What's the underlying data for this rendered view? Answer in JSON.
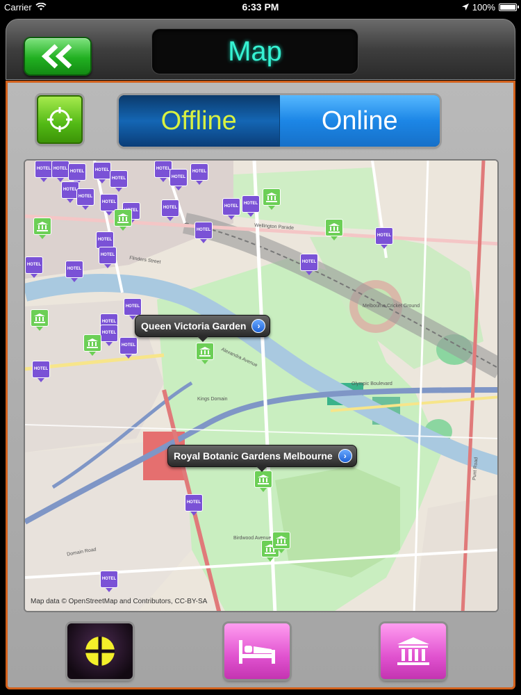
{
  "status_bar": {
    "carrier": "Carrier",
    "time": "6:33 PM",
    "battery": "100%",
    "icons": [
      "wifi-icon",
      "location-arrow-icon",
      "battery-icon"
    ]
  },
  "nav": {
    "title": "Map",
    "back_icon": "double-chevron-left-icon"
  },
  "toolbar": {
    "locate_icon": "crosshair-icon",
    "segments": [
      {
        "label": "Offline",
        "selected": false
      },
      {
        "label": "Online",
        "selected": true
      }
    ]
  },
  "map": {
    "callouts": [
      {
        "label": "Queen Victoria Garden"
      },
      {
        "label": "Royal Botanic Gardens Melbourne"
      }
    ],
    "attribution": "Map data © OpenStreetMap and Contributors, CC-BY-SA",
    "hotel_pin_label": "HOTEL",
    "street_labels": [
      "Flinders Street",
      "Wellington Parade",
      "Olympic Boulevard",
      "Domain Road",
      "Punt Road",
      "Birdwood Avenue",
      "Alexandra Avenue",
      "Kings Domain",
      "Melbourne Cricket Ground"
    ]
  },
  "bottom_bar": {
    "buttons": [
      {
        "name": "compass",
        "icon": "compass-icon"
      },
      {
        "name": "hotels",
        "icon": "bed-icon"
      },
      {
        "name": "museums",
        "icon": "museum-icon"
      }
    ]
  },
  "colors": {
    "accent_frame": "#d3611c",
    "title_text": "#36f2d2",
    "offline_text": "#d8f142",
    "back_button": "#21b021",
    "category_button": "#e052cf",
    "hotel_pin": "#7a52d6",
    "museum_pin": "#6ccf56"
  }
}
